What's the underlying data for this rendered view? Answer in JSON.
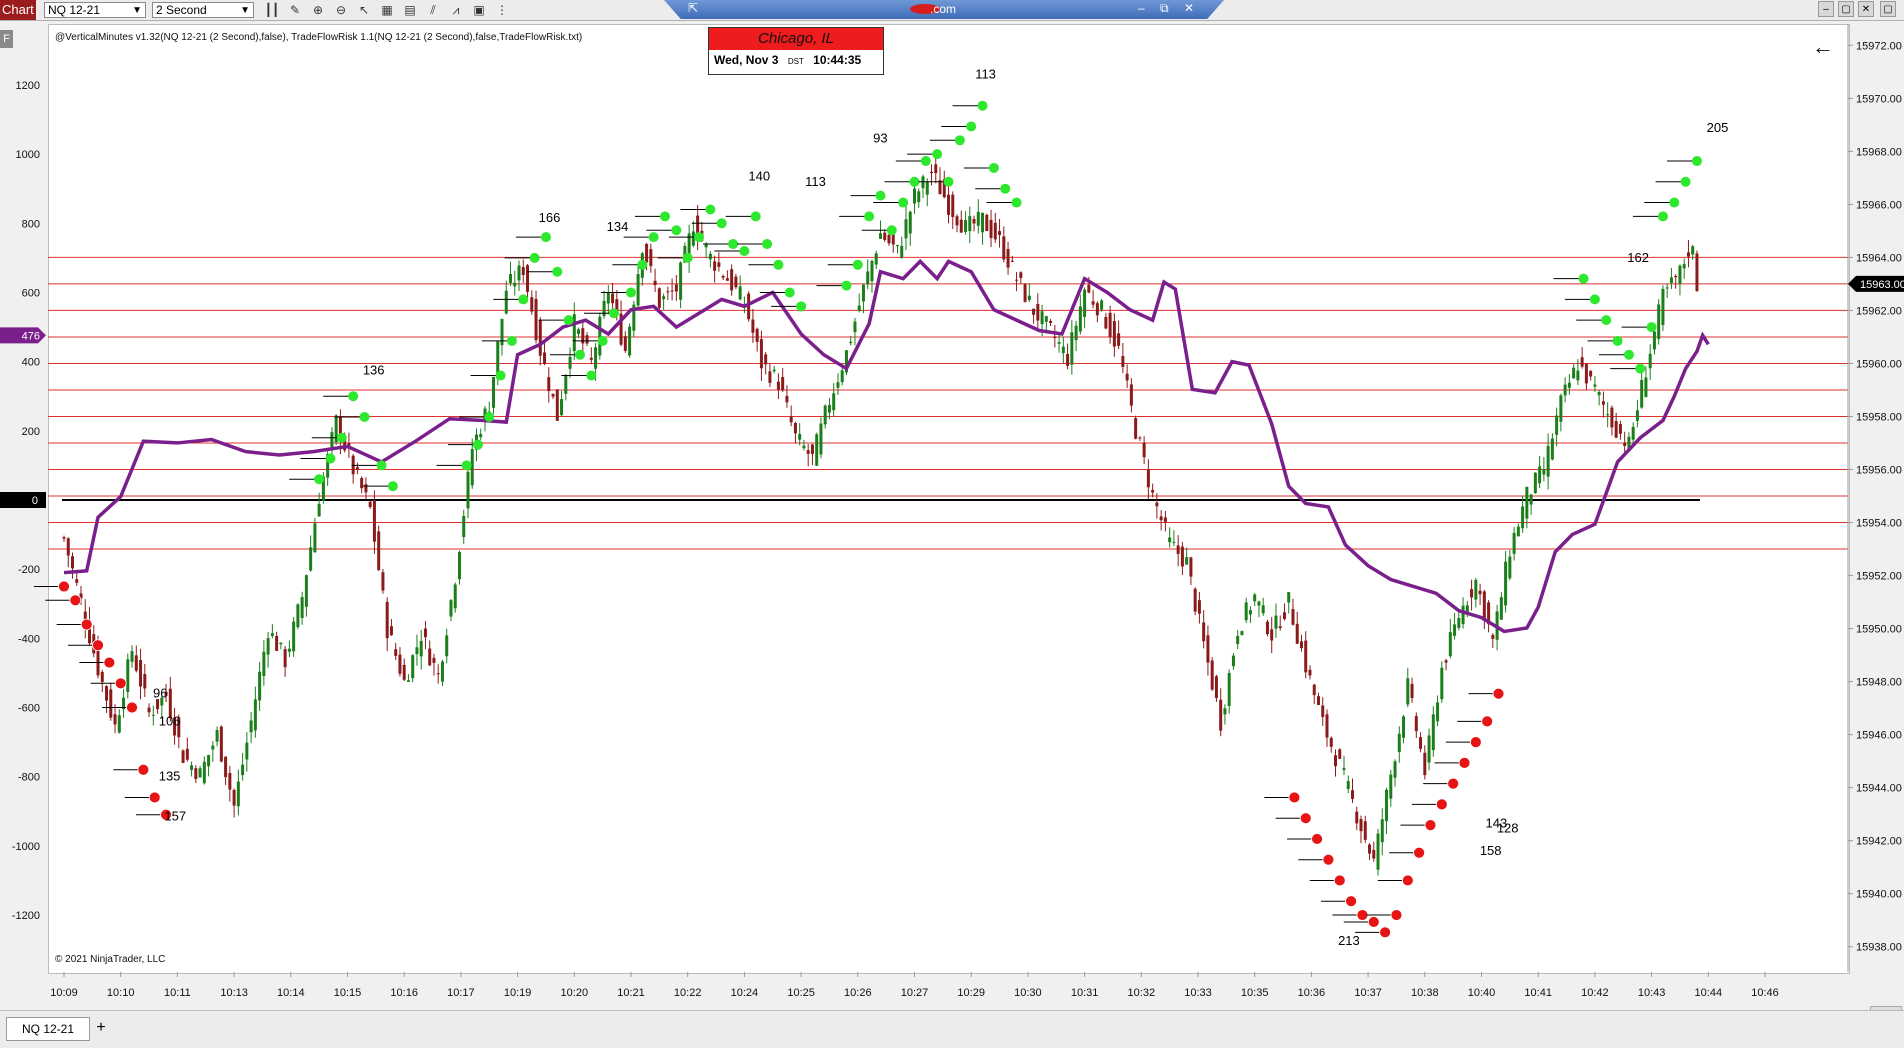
{
  "toolbar": {
    "chart_label": "Chart",
    "instrument": "NQ 12-21",
    "interval": "2 Second",
    "window_url": ".com"
  },
  "status_line": "@VerticalMinutes v1.32(NQ 12-21 (2 Second),false), TradeFlowRisk 1.1(NQ 12-21 (2 Second),false,TradeFlowRisk.txt)",
  "panel_label": "F",
  "clock_widget": {
    "city": "Chicago, IL",
    "date": "Wed, Nov 3",
    "dst": "DST",
    "time": "10:44:35"
  },
  "copyright": "© 2021 NinjaTrader, LLC",
  "bottom_tab": "NQ 12-21",
  "colors": {
    "up_candle": "#1a7f1a",
    "down_candle": "#8b1a1a",
    "buy_dot": "#2ee82e",
    "sell_dot": "#e61414",
    "indicator_line": "#7a1f8c",
    "level_lines": "#e03030",
    "price_marker": "#000000",
    "indicator_marker": "#7a1f8c"
  },
  "chart_data": {
    "type": "candlestick",
    "time_axis": [
      "10:09",
      "10:10",
      "10:11",
      "10:13",
      "10:14",
      "10:15",
      "10:16",
      "10:17",
      "10:19",
      "10:20",
      "10:21",
      "10:22",
      "10:24",
      "10:25",
      "10:26",
      "10:27",
      "10:29",
      "10:30",
      "10:31",
      "10:32",
      "10:33",
      "10:35",
      "10:36",
      "10:37",
      "10:38",
      "10:40",
      "10:41",
      "10:42",
      "10:43",
      "10:44",
      "10:46"
    ],
    "price_axis": {
      "ticks": [
        "15972.00",
        "15970.00",
        "15968.00",
        "15966.00",
        "15964.00",
        "15962.00",
        "15960.00",
        "15958.00",
        "15956.00",
        "15954.00",
        "15952.00",
        "15950.00",
        "15948.00",
        "15946.00",
        "15944.00",
        "15942.00",
        "15940.00",
        "15938.00"
      ],
      "range": [
        15937.5,
        15972.2
      ]
    },
    "indicator_axis": {
      "ticks": [
        "1200",
        "1000",
        "800",
        "600",
        "400",
        "200",
        "0",
        "-200",
        "-400",
        "-600",
        "-800",
        "-1000",
        "-1200"
      ],
      "range": [
        -1330,
        1330
      ]
    },
    "current_price": "15963.00",
    "indicator_value": "476",
    "zero_label": "0",
    "price_series": [
      {
        "t": 0,
        "p": 15953.4
      },
      {
        "t": 0.3,
        "p": 15951.0
      },
      {
        "t": 0.6,
        "p": 15948.5
      },
      {
        "t": 0.9,
        "p": 15946.3
      },
      {
        "t": 1.2,
        "p": 15949.2
      },
      {
        "t": 1.5,
        "p": 15946.8
      },
      {
        "t": 1.8,
        "p": 15947.5
      },
      {
        "t": 2.1,
        "p": 15945.2
      },
      {
        "t": 2.4,
        "p": 15944.5
      },
      {
        "t": 2.7,
        "p": 15946.0
      },
      {
        "t": 3.0,
        "p": 15943.3
      },
      {
        "t": 3.3,
        "p": 15946.5
      },
      {
        "t": 3.6,
        "p": 15950.0
      },
      {
        "t": 3.9,
        "p": 15948.8
      },
      {
        "t": 4.2,
        "p": 15951.2
      },
      {
        "t": 4.5,
        "p": 15955.0
      },
      {
        "t": 4.8,
        "p": 15957.8
      },
      {
        "t": 5.1,
        "p": 15956.0
      },
      {
        "t": 5.4,
        "p": 15954.5
      },
      {
        "t": 5.7,
        "p": 15950.0
      },
      {
        "t": 6.0,
        "p": 15948.0
      },
      {
        "t": 6.3,
        "p": 15949.8
      },
      {
        "t": 6.6,
        "p": 15948.2
      },
      {
        "t": 6.9,
        "p": 15952.0
      },
      {
        "t": 7.2,
        "p": 15956.8
      },
      {
        "t": 7.5,
        "p": 15958.5
      },
      {
        "t": 7.8,
        "p": 15962.8
      },
      {
        "t": 8.1,
        "p": 15963.6
      },
      {
        "t": 8.4,
        "p": 15960.5
      },
      {
        "t": 8.7,
        "p": 15958.0
      },
      {
        "t": 9.0,
        "p": 15961.5
      },
      {
        "t": 9.3,
        "p": 15960.0
      },
      {
        "t": 9.6,
        "p": 15962.8
      },
      {
        "t": 9.9,
        "p": 15960.5
      },
      {
        "t": 10.2,
        "p": 15964.5
      },
      {
        "t": 10.5,
        "p": 15962.3
      },
      {
        "t": 10.8,
        "p": 15962.8
      },
      {
        "t": 11.1,
        "p": 15965.3
      },
      {
        "t": 11.4,
        "p": 15964.0
      },
      {
        "t": 11.7,
        "p": 15963.2
      },
      {
        "t": 12.0,
        "p": 15962.3
      },
      {
        "t": 12.3,
        "p": 15960.0
      },
      {
        "t": 12.6,
        "p": 15959.3
      },
      {
        "t": 12.9,
        "p": 15957.2
      },
      {
        "t": 13.2,
        "p": 15956.4
      },
      {
        "t": 13.5,
        "p": 15958.6
      },
      {
        "t": 13.8,
        "p": 15960.4
      },
      {
        "t": 14.1,
        "p": 15962.8
      },
      {
        "t": 14.4,
        "p": 15964.9
      },
      {
        "t": 14.7,
        "p": 15964.2
      },
      {
        "t": 15.0,
        "p": 15966.3
      },
      {
        "t": 15.3,
        "p": 15967.2
      },
      {
        "t": 15.6,
        "p": 15966.0
      },
      {
        "t": 15.9,
        "p": 15965.1
      },
      {
        "t": 16.2,
        "p": 15965.4
      },
      {
        "t": 16.5,
        "p": 15964.6
      },
      {
        "t": 16.8,
        "p": 15963.2
      },
      {
        "t": 17.1,
        "p": 15962.0
      },
      {
        "t": 17.4,
        "p": 15961.2
      },
      {
        "t": 17.7,
        "p": 15960.2
      },
      {
        "t": 18.0,
        "p": 15962.8
      },
      {
        "t": 18.3,
        "p": 15962.0
      },
      {
        "t": 18.6,
        "p": 15960.5
      },
      {
        "t": 18.9,
        "p": 15957.5
      },
      {
        "t": 19.2,
        "p": 15955.0
      },
      {
        "t": 19.5,
        "p": 15953.2
      },
      {
        "t": 19.8,
        "p": 15952.5
      },
      {
        "t": 20.1,
        "p": 15949.4
      },
      {
        "t": 20.4,
        "p": 15946.5
      },
      {
        "t": 20.7,
        "p": 15950.0
      },
      {
        "t": 21.0,
        "p": 15951.2
      },
      {
        "t": 21.3,
        "p": 15949.8
      },
      {
        "t": 21.6,
        "p": 15951.0
      },
      {
        "t": 21.9,
        "p": 15948.6
      },
      {
        "t": 22.2,
        "p": 15946.4
      },
      {
        "t": 22.5,
        "p": 15944.8
      },
      {
        "t": 22.8,
        "p": 15943.0
      },
      {
        "t": 23.1,
        "p": 15941.2
      },
      {
        "t": 23.4,
        "p": 15944.5
      },
      {
        "t": 23.7,
        "p": 15947.8
      },
      {
        "t": 24.0,
        "p": 15944.6
      },
      {
        "t": 24.3,
        "p": 15948.5
      },
      {
        "t": 24.6,
        "p": 15950.5
      },
      {
        "t": 24.9,
        "p": 15951.8
      },
      {
        "t": 25.2,
        "p": 15949.5
      },
      {
        "t": 25.5,
        "p": 15953.0
      },
      {
        "t": 25.8,
        "p": 15955.0
      },
      {
        "t": 26.1,
        "p": 15956.0
      },
      {
        "t": 26.4,
        "p": 15958.5
      },
      {
        "t": 26.7,
        "p": 15960.0
      },
      {
        "t": 27.0,
        "p": 15959.0
      },
      {
        "t": 27.3,
        "p": 15957.8
      },
      {
        "t": 27.6,
        "p": 15956.9
      },
      {
        "t": 27.9,
        "p": 15959.8
      },
      {
        "t": 28.2,
        "p": 15962.5
      },
      {
        "t": 28.5,
        "p": 15963.4
      },
      {
        "t": 28.7,
        "p": 15964.6
      },
      {
        "t": 28.8,
        "p": 15963.0
      }
    ],
    "indicator_series": [
      {
        "t": 0,
        "v": -210
      },
      {
        "t": 0.4,
        "v": -205
      },
      {
        "t": 0.6,
        "v": -50
      },
      {
        "t": 1.0,
        "v": 10
      },
      {
        "t": 1.4,
        "v": 170
      },
      {
        "t": 2.0,
        "v": 165
      },
      {
        "t": 2.6,
        "v": 175
      },
      {
        "t": 3.2,
        "v": 140
      },
      {
        "t": 3.8,
        "v": 130
      },
      {
        "t": 4.4,
        "v": 140
      },
      {
        "t": 5.0,
        "v": 155
      },
      {
        "t": 5.6,
        "v": 110
      },
      {
        "t": 6.2,
        "v": 170
      },
      {
        "t": 6.8,
        "v": 235
      },
      {
        "t": 7.4,
        "v": 230
      },
      {
        "t": 7.8,
        "v": 225
      },
      {
        "t": 8.0,
        "v": 420
      },
      {
        "t": 8.4,
        "v": 450
      },
      {
        "t": 8.8,
        "v": 500
      },
      {
        "t": 9.2,
        "v": 520
      },
      {
        "t": 9.6,
        "v": 480
      },
      {
        "t": 10.0,
        "v": 550
      },
      {
        "t": 10.4,
        "v": 560
      },
      {
        "t": 10.8,
        "v": 500
      },
      {
        "t": 11.2,
        "v": 540
      },
      {
        "t": 11.6,
        "v": 580
      },
      {
        "t": 12.0,
        "v": 560
      },
      {
        "t": 12.5,
        "v": 600
      },
      {
        "t": 13.0,
        "v": 480
      },
      {
        "t": 13.4,
        "v": 420
      },
      {
        "t": 13.8,
        "v": 380
      },
      {
        "t": 14.2,
        "v": 510
      },
      {
        "t": 14.4,
        "v": 660
      },
      {
        "t": 14.8,
        "v": 640
      },
      {
        "t": 15.1,
        "v": 690
      },
      {
        "t": 15.4,
        "v": 640
      },
      {
        "t": 15.6,
        "v": 690
      },
      {
        "t": 16.0,
        "v": 660
      },
      {
        "t": 16.4,
        "v": 550
      },
      {
        "t": 16.8,
        "v": 520
      },
      {
        "t": 17.2,
        "v": 490
      },
      {
        "t": 17.6,
        "v": 480
      },
      {
        "t": 18.0,
        "v": 640
      },
      {
        "t": 18.4,
        "v": 600
      },
      {
        "t": 18.8,
        "v": 550
      },
      {
        "t": 19.2,
        "v": 520
      },
      {
        "t": 19.4,
        "v": 630
      },
      {
        "t": 19.6,
        "v": 610
      },
      {
        "t": 19.9,
        "v": 320
      },
      {
        "t": 20.3,
        "v": 310
      },
      {
        "t": 20.6,
        "v": 400
      },
      {
        "t": 20.9,
        "v": 390
      },
      {
        "t": 21.3,
        "v": 220
      },
      {
        "t": 21.6,
        "v": 40
      },
      {
        "t": 21.9,
        "v": -10
      },
      {
        "t": 22.3,
        "v": -20
      },
      {
        "t": 22.6,
        "v": -130
      },
      {
        "t": 23.0,
        "v": -190
      },
      {
        "t": 23.4,
        "v": -230
      },
      {
        "t": 23.8,
        "v": -250
      },
      {
        "t": 24.2,
        "v": -270
      },
      {
        "t": 24.6,
        "v": -320
      },
      {
        "t": 25.0,
        "v": -340
      },
      {
        "t": 25.4,
        "v": -380
      },
      {
        "t": 25.8,
        "v": -370
      },
      {
        "t": 26.0,
        "v": -310
      },
      {
        "t": 26.3,
        "v": -150
      },
      {
        "t": 26.6,
        "v": -100
      },
      {
        "t": 27.0,
        "v": -70
      },
      {
        "t": 27.4,
        "v": 110
      },
      {
        "t": 27.8,
        "v": 180
      },
      {
        "t": 28.2,
        "v": 230
      },
      {
        "t": 28.4,
        "v": 300
      },
      {
        "t": 28.6,
        "v": 380
      },
      {
        "t": 28.8,
        "v": 430
      },
      {
        "t": 28.9,
        "v": 476
      },
      {
        "t": 29.0,
        "v": 450
      }
    ],
    "buy_markers": [
      {
        "t": 4.5,
        "v": 60
      },
      {
        "t": 4.7,
        "v": 120
      },
      {
        "t": 4.9,
        "v": 180
      },
      {
        "t": 5.1,
        "v": 300
      },
      {
        "t": 5.3,
        "v": 240
      },
      {
        "t": 5.6,
        "v": 100
      },
      {
        "t": 5.8,
        "v": 40
      },
      {
        "t": 7.1,
        "v": 100
      },
      {
        "t": 7.3,
        "v": 160
      },
      {
        "t": 7.5,
        "v": 240
      },
      {
        "t": 7.7,
        "v": 360
      },
      {
        "t": 7.9,
        "v": 460
      },
      {
        "t": 8.1,
        "v": 580
      },
      {
        "t": 8.3,
        "v": 700
      },
      {
        "t": 8.5,
        "v": 760
      },
      {
        "t": 8.7,
        "v": 660
      },
      {
        "t": 8.9,
        "v": 520
      },
      {
        "t": 9.1,
        "v": 420
      },
      {
        "t": 9.3,
        "v": 360
      },
      {
        "t": 9.5,
        "v": 460
      },
      {
        "t": 9.7,
        "v": 540
      },
      {
        "t": 10.0,
        "v": 600
      },
      {
        "t": 10.2,
        "v": 680
      },
      {
        "t": 10.4,
        "v": 760
      },
      {
        "t": 10.6,
        "v": 820
      },
      {
        "t": 10.8,
        "v": 780
      },
      {
        "t": 11.0,
        "v": 700
      },
      {
        "t": 11.2,
        "v": 760
      },
      {
        "t": 11.4,
        "v": 840
      },
      {
        "t": 11.6,
        "v": 800
      },
      {
        "t": 11.8,
        "v": 740
      },
      {
        "t": 12.0,
        "v": 720
      },
      {
        "t": 12.2,
        "v": 820
      },
      {
        "t": 12.4,
        "v": 740
      },
      {
        "t": 12.6,
        "v": 680
      },
      {
        "t": 12.8,
        "v": 600
      },
      {
        "t": 13.0,
        "v": 560
      },
      {
        "t": 13.8,
        "v": 620
      },
      {
        "t": 14.0,
        "v": 680
      },
      {
        "t": 14.2,
        "v": 820
      },
      {
        "t": 14.4,
        "v": 880
      },
      {
        "t": 14.6,
        "v": 780
      },
      {
        "t": 14.8,
        "v": 860
      },
      {
        "t": 15.0,
        "v": 920
      },
      {
        "t": 15.2,
        "v": 980
      },
      {
        "t": 15.4,
        "v": 1000
      },
      {
        "t": 15.6,
        "v": 920
      },
      {
        "t": 15.8,
        "v": 1040
      },
      {
        "t": 16.0,
        "v": 1080
      },
      {
        "t": 16.2,
        "v": 1140
      },
      {
        "t": 16.4,
        "v": 960
      },
      {
        "t": 16.6,
        "v": 900
      },
      {
        "t": 16.8,
        "v": 860
      },
      {
        "t": 26.8,
        "v": 640
      },
      {
        "t": 27.0,
        "v": 580
      },
      {
        "t": 27.2,
        "v": 520
      },
      {
        "t": 27.4,
        "v": 460
      },
      {
        "t": 27.6,
        "v": 420
      },
      {
        "t": 27.8,
        "v": 380
      },
      {
        "t": 28.0,
        "v": 500
      },
      {
        "t": 28.2,
        "v": 820
      },
      {
        "t": 28.4,
        "v": 860
      },
      {
        "t": 28.6,
        "v": 920
      },
      {
        "t": 28.8,
        "v": 980
      }
    ],
    "sell_markers": [
      {
        "t": 0.0,
        "v": -250
      },
      {
        "t": 0.2,
        "v": -290
      },
      {
        "t": 0.4,
        "v": -360
      },
      {
        "t": 0.6,
        "v": -420
      },
      {
        "t": 0.8,
        "v": -470
      },
      {
        "t": 1.0,
        "v": -530
      },
      {
        "t": 1.2,
        "v": -600
      },
      {
        "t": 1.4,
        "v": -780
      },
      {
        "t": 1.6,
        "v": -860
      },
      {
        "t": 1.8,
        "v": -910
      },
      {
        "t": 21.7,
        "v": -860
      },
      {
        "t": 21.9,
        "v": -920
      },
      {
        "t": 22.1,
        "v": -980
      },
      {
        "t": 22.3,
        "v": -1040
      },
      {
        "t": 22.5,
        "v": -1100
      },
      {
        "t": 22.7,
        "v": -1160
      },
      {
        "t": 22.9,
        "v": -1200
      },
      {
        "t": 23.1,
        "v": -1220
      },
      {
        "t": 23.3,
        "v": -1250
      },
      {
        "t": 23.5,
        "v": -1200
      },
      {
        "t": 23.7,
        "v": -1100
      },
      {
        "t": 23.9,
        "v": -1020
      },
      {
        "t": 24.1,
        "v": -940
      },
      {
        "t": 24.3,
        "v": -880
      },
      {
        "t": 24.5,
        "v": -820
      },
      {
        "t": 24.7,
        "v": -760
      },
      {
        "t": 24.9,
        "v": -700
      },
      {
        "t": 25.1,
        "v": -640
      },
      {
        "t": 25.3,
        "v": -560
      }
    ],
    "count_labels": [
      {
        "t": 16.0,
        "v": 1230,
        "text": "113"
      },
      {
        "t": 22.4,
        "v": -1275,
        "text": "213"
      },
      {
        "t": 28.9,
        "v": 1075,
        "text": "205"
      },
      {
        "t": 1.6,
        "v": -800,
        "text": "135"
      },
      {
        "t": 1.7,
        "v": -915,
        "text": "157"
      },
      {
        "t": 1.5,
        "v": -560,
        "text": "96"
      },
      {
        "t": 1.6,
        "v": -640,
        "text": "106"
      },
      {
        "t": 27.5,
        "v": 700,
        "text": "162"
      },
      {
        "t": 25.0,
        "v": -935,
        "text": "143"
      },
      {
        "t": 25.2,
        "v": -950,
        "text": "128"
      },
      {
        "t": 24.9,
        "v": -1015,
        "text": "158"
      },
      {
        "t": 12.0,
        "v": 935,
        "text": "140"
      },
      {
        "t": 13.0,
        "v": 920,
        "text": "113"
      },
      {
        "t": 14.2,
        "v": 1045,
        "text": "93"
      },
      {
        "t": 8.3,
        "v": 815,
        "text": "166"
      },
      {
        "t": 9.5,
        "v": 790,
        "text": "134"
      },
      {
        "t": 5.2,
        "v": 375,
        "text": "136"
      }
    ],
    "level_lines": [
      15964.0,
      15963.0,
      15962.0,
      15961.0,
      15960.0,
      15959.0,
      15958.0,
      15957.0,
      15956.0,
      15955.0,
      15954.0,
      15953.0
    ],
    "zero_line_value": 0
  }
}
